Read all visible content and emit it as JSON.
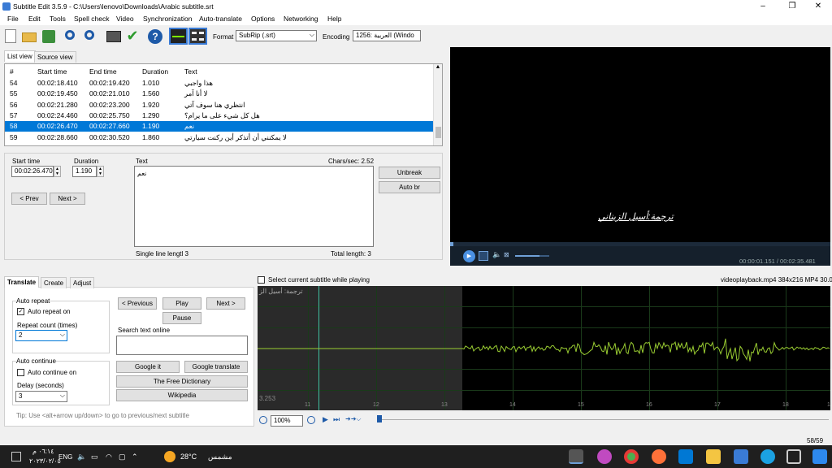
{
  "window": {
    "title": "Subtitle Edit 3.5.9 - C:\\Users\\lenovo\\Downloads\\Arabic subtitle.srt",
    "minimize": "–",
    "maximize": "❐",
    "close": "✕"
  },
  "menu": [
    "File",
    "Edit",
    "Tools",
    "Spell check",
    "Video",
    "Synchronization",
    "Auto-translate",
    "Options",
    "Networking",
    "Help"
  ],
  "toolbar": {
    "format_label": "Format",
    "format_value": "SubRip (.srt)",
    "encoding_label": "Encoding",
    "encoding_value": "1256: العربية (Windo"
  },
  "tabs_top": {
    "list_view": "List view",
    "source_view": "Source view"
  },
  "list": {
    "headers": [
      "#",
      "Start time",
      "End time",
      "Duration",
      "Text"
    ],
    "rows": [
      {
        "num": "54",
        "start": "00:02:18.410",
        "end": "00:02:19.420",
        "dur": "1.010",
        "text": "هذا واجبي"
      },
      {
        "num": "55",
        "start": "00:02:19.450",
        "end": "00:02:21.010",
        "dur": "1.560",
        "text": "لا أنا آمر"
      },
      {
        "num": "56",
        "start": "00:02:21.280",
        "end": "00:02:23.200",
        "dur": "1.920",
        "text": "انتظري هنا سوف آتي"
      },
      {
        "num": "57",
        "start": "00:02:24.460",
        "end": "00:02:25.750",
        "dur": "1.290",
        "text": "هل كل شيء على ما يرام؟"
      },
      {
        "num": "58",
        "start": "00:02:26.470",
        "end": "00:02:27.660",
        "dur": "1.190",
        "text": "نعم"
      },
      {
        "num": "59",
        "start": "00:02:28.660",
        "end": "00:02:30.520",
        "dur": "1.860",
        "text": "لا يمكنني أن أتذكر أين ركنت سيارتي"
      }
    ]
  },
  "editor": {
    "start_time_label": "Start time",
    "start_time_value": "00:02:26.470",
    "duration_label": "Duration",
    "duration_value": "1.190",
    "text_label": "Text",
    "chars_sec": "Chars/sec: 2.52",
    "text_value": "نعم",
    "prev": "< Prev",
    "next": "Next >",
    "unbreak": "Unbreak",
    "auto_br": "Auto br",
    "single_line": "Single line lengtl 3",
    "total_length": "Total length: 3"
  },
  "video": {
    "subtitle": "ترجمة:أسيل الزيناني",
    "time": "00:00:01.151 / 00:02:35.481"
  },
  "bottom_tabs": {
    "translate": "Translate",
    "create": "Create",
    "adjust": "Adjust"
  },
  "translate": {
    "auto_repeat_group": "Auto repeat",
    "auto_repeat_on": "Auto repeat on",
    "repeat_count_label": "Repeat count (times)",
    "repeat_count_value": "2",
    "auto_continue_group": "Auto continue",
    "auto_continue_on": "Auto continue on",
    "delay_label": "Delay (seconds)",
    "delay_value": "3",
    "previous": "< Previous",
    "play": "Play",
    "next": "Next >",
    "pause": "Pause",
    "search_label": "Search text online",
    "google_it": "Google it",
    "google_translate": "Google translate",
    "free_dictionary": "The Free Dictionary",
    "wikipedia": "Wikipedia",
    "tip": "Tip: Use <alt+arrow up/down> to go to previous/next subtitle"
  },
  "waveform": {
    "select_current": "Select current subtitle while playing",
    "file_info": "videoplayback.mp4 384x216 MP4 30.0",
    "overlay_text": "ترجمة: أسيل الز",
    "time_label": "3.253",
    "ticks": [
      "11",
      "12",
      "13",
      "14",
      "15",
      "16",
      "17",
      "18",
      "19"
    ],
    "zoom": "100%",
    "count": "58/59",
    "accent": "#9acd32"
  },
  "taskbar": {
    "time": "٠٦:١٤ م",
    "date": "٢٠٢٣/٠٢/٠٥",
    "lang": "ENG",
    "weather_temp": "28°C",
    "weather_text": "مشمس"
  }
}
